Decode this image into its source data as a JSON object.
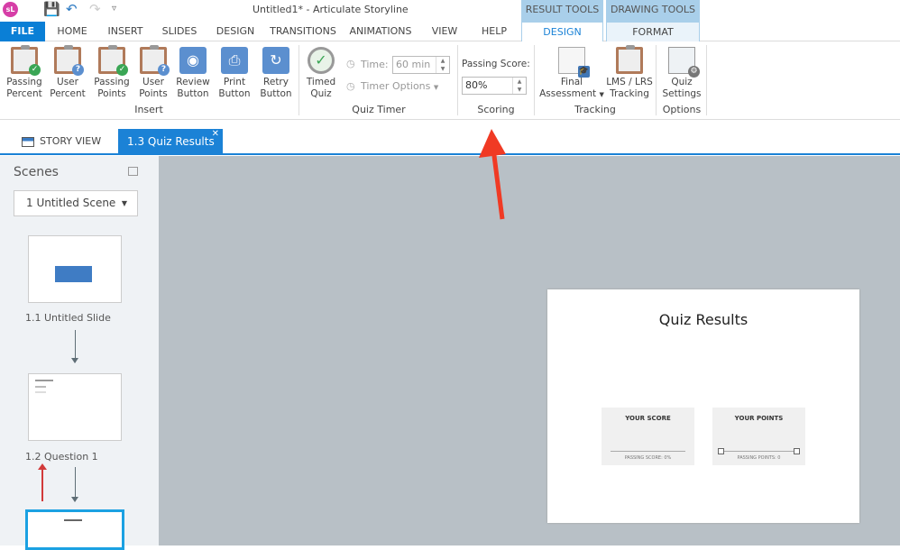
{
  "window": {
    "title": "Untitled1* -  Articulate Storyline",
    "logo": "sL"
  },
  "quick_access": [
    "save-icon",
    "undo-icon",
    "redo-icon",
    "customize-icon"
  ],
  "context_headers": {
    "result_tools": "RESULT TOOLS",
    "drawing_tools": "DRAWING TOOLS"
  },
  "tabs": {
    "file": "FILE",
    "home": "HOME",
    "insert": "INSERT",
    "slides": "SLIDES",
    "design": "DESIGN",
    "transitions": "TRANSITIONS",
    "animations": "ANIMATIONS",
    "view": "VIEW",
    "help": "HELP",
    "result_design": "DESIGN",
    "format": "FORMAT"
  },
  "ribbon": {
    "insert": {
      "label": "Insert",
      "buttons": [
        {
          "l1": "Passing",
          "l2": "Percent"
        },
        {
          "l1": "User",
          "l2": "Percent"
        },
        {
          "l1": "Passing",
          "l2": "Points"
        },
        {
          "l1": "User",
          "l2": "Points"
        },
        {
          "l1": "Review",
          "l2": "Button"
        },
        {
          "l1": "Print",
          "l2": "Button"
        },
        {
          "l1": "Retry",
          "l2": "Button"
        }
      ]
    },
    "quiz_timer": {
      "label": "Quiz Timer",
      "timed_l1": "Timed",
      "timed_l2": "Quiz",
      "time_label": "Time:",
      "time_value": "60 min",
      "timer_options": "Timer Options"
    },
    "scoring": {
      "label": "Scoring",
      "passing_score_label": "Passing Score:",
      "passing_score_value": "80%"
    },
    "tracking": {
      "label": "Tracking",
      "final_l1": "Final",
      "final_l2": "Assessment",
      "lms_l1": "LMS / LRS",
      "lms_l2": "Tracking"
    },
    "options": {
      "label": "Options",
      "quiz_l1": "Quiz",
      "quiz_l2": "Settings"
    }
  },
  "doc_tabs": {
    "story_view": "STORY VIEW",
    "active": "1.3 Quiz Results"
  },
  "sidebar": {
    "title": "Scenes",
    "scene_select": "1 Untitled Scene",
    "slides": [
      {
        "label": "1.1 Untitled Slide"
      },
      {
        "label": "1.2 Question 1"
      },
      {
        "label": ""
      }
    ]
  },
  "slide": {
    "title": "Quiz Results",
    "score_card": {
      "title": "YOUR SCORE",
      "footer": "PASSING SCORE: 0%"
    },
    "points_card": {
      "title": "YOUR POINTS",
      "footer": "PASSING POINTS: 0"
    }
  },
  "colors": {
    "accent": "#1b82d6",
    "annotation": "#f03a24"
  }
}
